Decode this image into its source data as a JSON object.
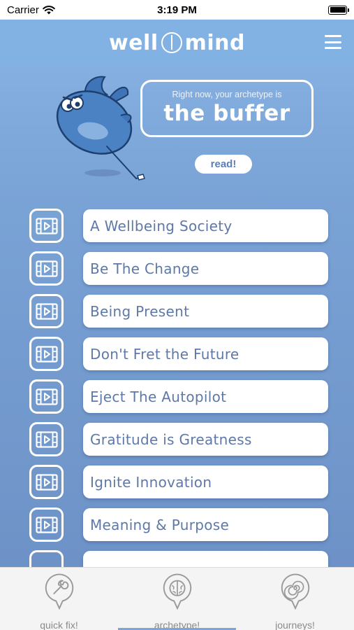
{
  "status_bar": {
    "carrier": "Carrier",
    "time": "3:19 PM"
  },
  "header": {
    "logo_left": "well",
    "logo_right": "mind"
  },
  "hero": {
    "caption": "Right now, your archetype is",
    "archetype": "the buffer",
    "read_label": "read!"
  },
  "videos": [
    {
      "label": "A Wellbeing Society",
      "icon": "video-icon"
    },
    {
      "label": "Be The Change",
      "icon": "video-icon"
    },
    {
      "label": "Being Present",
      "icon": "video-icon"
    },
    {
      "label": "Don't Fret the Future",
      "icon": "video-icon"
    },
    {
      "label": "Eject The Autopilot",
      "icon": "video-icon"
    },
    {
      "label": "Gratitude is Greatness",
      "icon": "video-icon"
    },
    {
      "label": "Ignite Innovation",
      "icon": "video-icon"
    },
    {
      "label": "Meaning & Purpose",
      "icon": "video-icon"
    },
    {
      "label": "",
      "icon": "video-icon"
    }
  ],
  "tabs": [
    {
      "label": "quick fix!",
      "icon": "wrench-icon"
    },
    {
      "label": "archetype!",
      "icon": "brain-icon"
    },
    {
      "label": "journeys!",
      "icon": "spiral-icon"
    }
  ],
  "colors": {
    "header": "#82b1e3",
    "background_top": "#8bb6e6",
    "background_bottom": "#6b8fc4",
    "item_text": "#5e79a8",
    "active_tab_indicator": "#7aa6d9"
  }
}
